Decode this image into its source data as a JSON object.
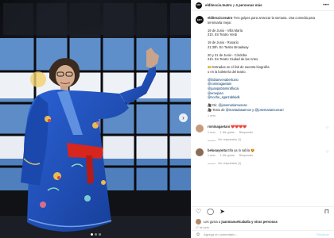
{
  "header": {
    "username": "elditeccio.teatro",
    "and_text": "y",
    "others_text": "4 personas más"
  },
  "caption": {
    "username": "elditeccio.teatro",
    "intro": "Tres golpes para arrancar la semana. Una comedia para terminarla mejor.",
    "line_groups": [
      [
        "19 de Junio - Villa María",
        "21h. En Teatro Verdi"
      ],
      [
        "19 de Junio - Rosario",
        "21:30h. En Teatro Broadway"
      ],
      [
        "20 y 21 de Junio - Córdoba",
        "21h. En Teatro Ciudad de las Artes"
      ],
      [
        "🎫 Entradas en el link de nuestra biografía",
        "o en la boletería del teatro."
      ]
    ],
    "tags": [
      "@fabianvenabertuvio",
      "@rominagaetani",
      "@juanpablomiraflucai",
      "@emepian",
      "@noche_sgarzablaidk"
    ],
    "credit_1_prefix": "🎥 Dir.",
    "credit_1_mention": "@josemariamuscan",
    "credit_2_prefix": "🎥 Texto de",
    "credit_2_mentions": "@mariadasaenos y @josemariamuscari",
    "time": "1 sem."
  },
  "comments": [
    {
      "username": "rominagaetani",
      "text": "❤️❤️❤️❤️",
      "time": "1 sem",
      "likes": "1 Me gusta",
      "reply": "Responder",
      "replies": "Ver respuestas (1)"
    },
    {
      "username": "beluoayonta",
      "text": "Ella ya lo sabía 😍",
      "time": "1 sem",
      "likes": "1 Me gusta",
      "reply": "Responder",
      "replies": "Ver respuestas (1)"
    }
  ],
  "actions": {
    "like_icon": "♡",
    "comment_icon": "◯",
    "share_icon": "➤",
    "save_icon": "⊓"
  },
  "likes": {
    "prefix": "Les gusta a",
    "user": "juanmanuelcaballa",
    "suffix": "y otras personas"
  },
  "post_date": "17 de junio",
  "add_comment": {
    "placeholder": "Agrega un comentario...",
    "post_label": "Publicar"
  },
  "colors": {
    "link": "#00376b",
    "muted": "#8e8e8e",
    "kimono_blue": "#1f4fb8",
    "sash_red": "#d7261e",
    "flag_light_blue": "#74acdf"
  }
}
